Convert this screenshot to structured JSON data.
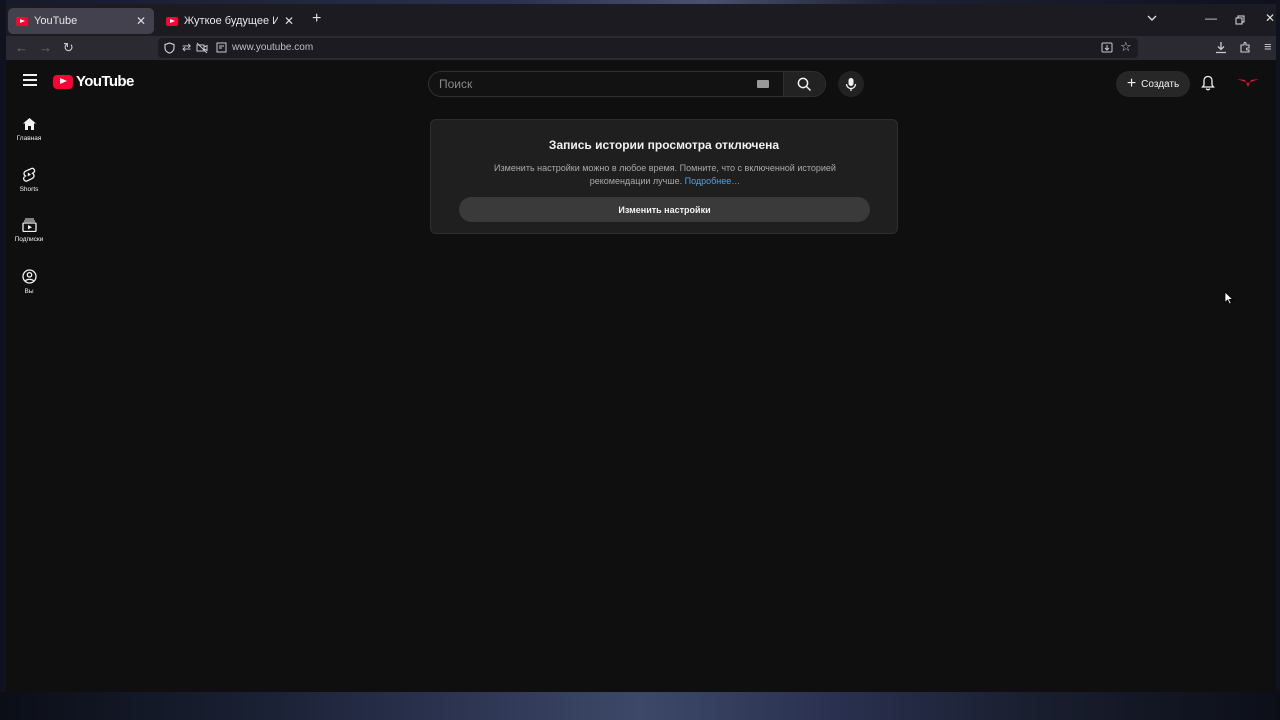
{
  "browser": {
    "tabs": [
      {
        "title": "YouTube",
        "active": true
      },
      {
        "title": "Жуткое будущее ИИ | Варлам",
        "active": false
      }
    ],
    "url": "www.youtube.com",
    "colors": {
      "tab_bg": "#1c1b22",
      "toolbar_bg": "#2b2a33",
      "active_tab": "#42414d"
    }
  },
  "youtube": {
    "logo_text": "YouTube",
    "search": {
      "placeholder": "Поиск"
    },
    "create_label": "Создать",
    "sidebar": [
      {
        "label": "Главная",
        "icon": "home-icon"
      },
      {
        "label": "Shorts",
        "icon": "shorts-icon"
      },
      {
        "label": "Подписки",
        "icon": "subscriptions-icon"
      },
      {
        "label": "Вы",
        "icon": "user-icon"
      }
    ],
    "history_card": {
      "title": "Запись истории просмотра отключена",
      "text": "Изменить настройки можно в любое время. Помните, что с включенной историей рекомендации лучше.",
      "link": "Подробнее…",
      "button": "Изменить настройки"
    },
    "colors": {
      "brand": "#ff0033",
      "link": "#3ea6ff",
      "bg": "#0f0f0f"
    }
  }
}
